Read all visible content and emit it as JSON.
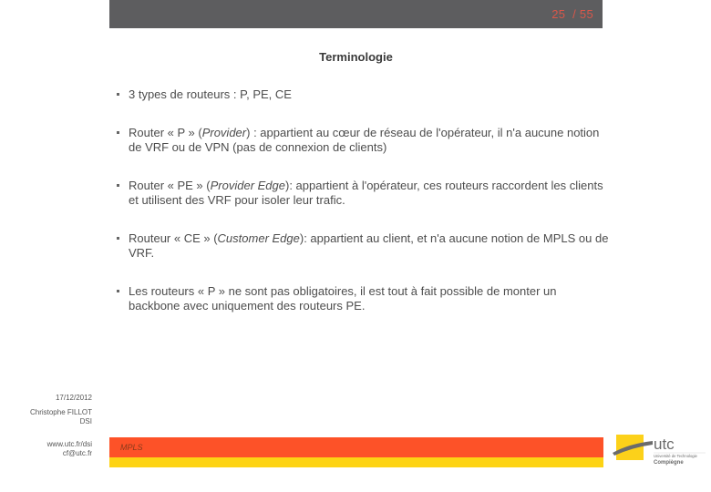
{
  "header": {
    "current_page": "25",
    "separator": " / ",
    "total_pages": "55",
    "counter_text": "25  / 55"
  },
  "slide": {
    "title": "Terminologie",
    "bullets": [
      {
        "parts": [
          {
            "text": "3 types de routeurs : P, PE, CE",
            "italic": false
          }
        ]
      },
      {
        "parts": [
          {
            "text": "Router « P » (",
            "italic": false
          },
          {
            "text": "Provider",
            "italic": true
          },
          {
            "text": ") : appartient au cœur de réseau de l'opérateur, il n'a aucune notion de VRF ou de VPN (pas de connexion de clients)",
            "italic": false
          }
        ]
      },
      {
        "parts": [
          {
            "text": "Router « PE » (",
            "italic": false
          },
          {
            "text": "Provider Edge",
            "italic": true
          },
          {
            "text": "): appartient à l'opérateur, ces routeurs raccordent les clients et utilisent des VRF pour isoler leur trafic.",
            "italic": false
          }
        ]
      },
      {
        "parts": [
          {
            "text": "Routeur « CE » (",
            "italic": false
          },
          {
            "text": "Customer Edge",
            "italic": true
          },
          {
            "text": "): appartient au client, et n'a aucune notion de MPLS ou de VRF.",
            "italic": false
          }
        ]
      },
      {
        "parts": [
          {
            "text": "Les routeurs « P » ne sont pas obligatoires, il est tout à fait possible de monter un backbone avec uniquement des routeurs PE.",
            "italic": false
          }
        ]
      }
    ]
  },
  "meta": {
    "date": "17/12/2012",
    "author": "Christophe FILLOT",
    "department": "DSI",
    "website": "www.utc.fr/dsi",
    "email": "cf@utc.fr"
  },
  "footer": {
    "label": "MPLS",
    "bar_color": "#fd5228",
    "stripe_color": "#fdd314"
  },
  "logo": {
    "name": "utc",
    "line1": "Université de Technologie",
    "line2": "Compiègne"
  }
}
